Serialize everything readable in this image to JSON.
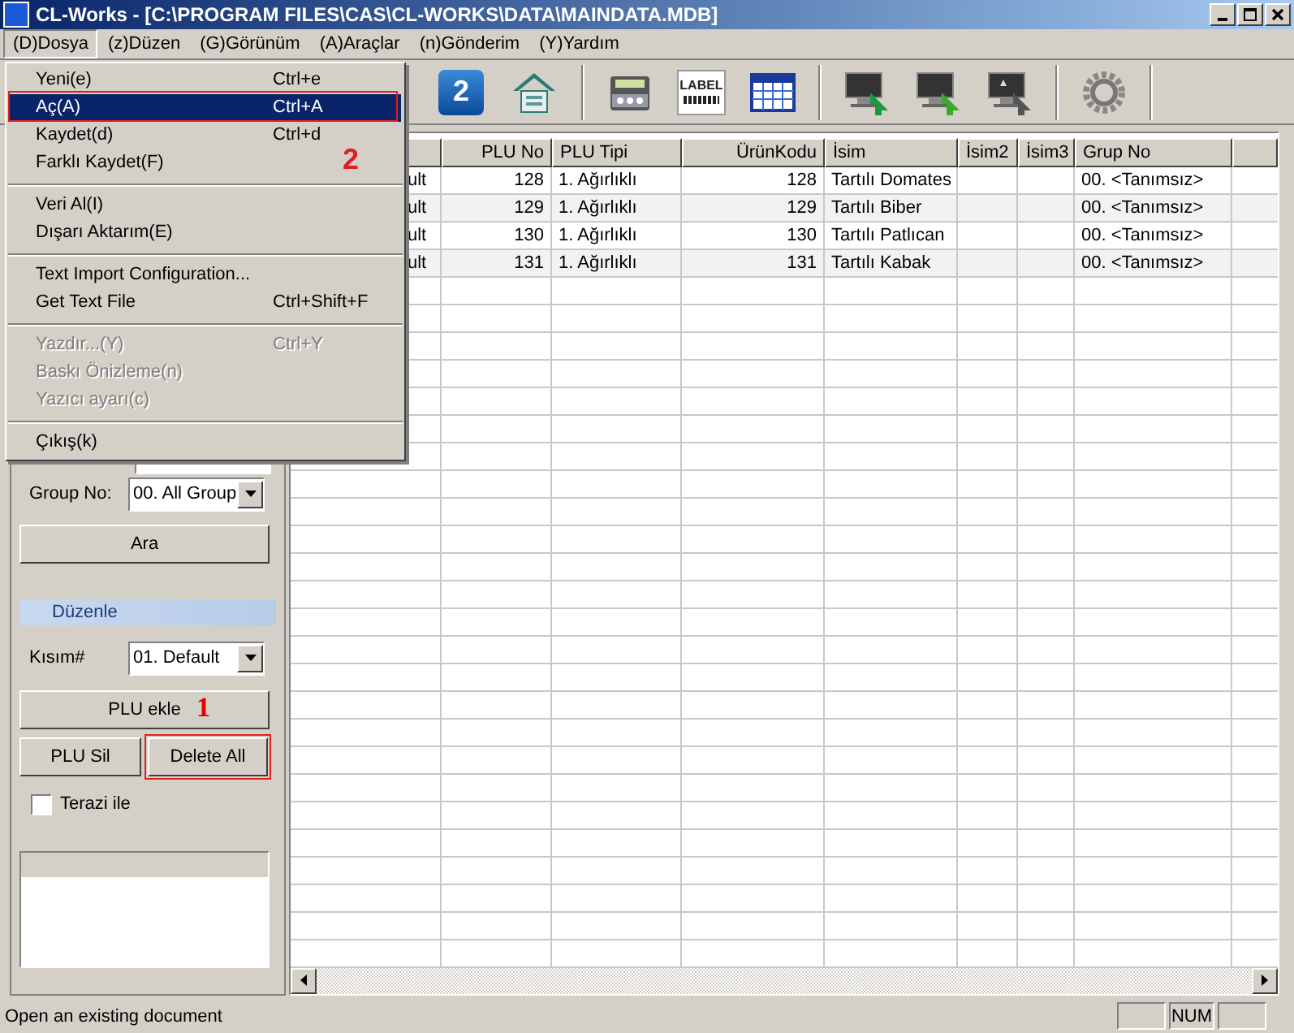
{
  "window": {
    "title": "CL-Works - [C:\\PROGRAM FILES\\CAS\\CL-WORKS\\DATA\\MAINDATA.MDB]"
  },
  "menu_bar": [
    {
      "label": "(D)Dosya",
      "selected": true
    },
    {
      "label": "(z)Düzen",
      "selected": false
    },
    {
      "label": "(G)Görünüm",
      "selected": false
    },
    {
      "label": "(A)Araçlar",
      "selected": false
    },
    {
      "label": "(n)Gönderim",
      "selected": false
    },
    {
      "label": "(Y)Yardım",
      "selected": false
    }
  ],
  "file_menu": {
    "annotation": "2",
    "items": [
      {
        "kind": "item",
        "label": "Yeni(e)",
        "shortcut": "Ctrl+e",
        "disabled": false,
        "selected": false
      },
      {
        "kind": "item",
        "label": "Aç(A)",
        "shortcut": "Ctrl+A",
        "disabled": false,
        "selected": true
      },
      {
        "kind": "item",
        "label": "Kaydet(d)",
        "shortcut": "Ctrl+d",
        "disabled": false,
        "selected": false
      },
      {
        "kind": "item",
        "label": "Farklı Kaydet(F)",
        "disabled": false,
        "selected": false
      },
      {
        "kind": "separator"
      },
      {
        "kind": "item",
        "label": "Veri Al(I)",
        "disabled": false,
        "selected": false
      },
      {
        "kind": "item",
        "label": "Dışarı Aktarım(E)",
        "disabled": false,
        "selected": false
      },
      {
        "kind": "separator"
      },
      {
        "kind": "item",
        "label": "Text Import Configuration...",
        "disabled": false,
        "selected": false
      },
      {
        "kind": "item",
        "label": "Get Text File",
        "shortcut": "Ctrl+Shift+F",
        "disabled": false,
        "selected": false
      },
      {
        "kind": "separator"
      },
      {
        "kind": "item",
        "label": "Yazdır...(Y)",
        "shortcut": "Ctrl+Y",
        "disabled": true,
        "selected": false
      },
      {
        "kind": "item",
        "label": "Baskı Önizleme(n)",
        "disabled": true,
        "selected": false
      },
      {
        "kind": "item",
        "label": "Yazıcı ayarı(c)",
        "disabled": true,
        "selected": false
      },
      {
        "kind": "separator"
      },
      {
        "kind": "item",
        "label": "Çıkış(k)",
        "disabled": false,
        "selected": false
      }
    ]
  },
  "toolbar": [
    {
      "kind": "number",
      "text": "2"
    },
    {
      "kind": "house"
    },
    {
      "kind": "separator"
    },
    {
      "kind": "scale"
    },
    {
      "kind": "label",
      "text": "LABEL"
    },
    {
      "kind": "grid"
    },
    {
      "kind": "separator"
    },
    {
      "kind": "monitor-green"
    },
    {
      "kind": "monitor-down"
    },
    {
      "kind": "monitor-star"
    },
    {
      "kind": "separator"
    },
    {
      "kind": "gear"
    },
    {
      "kind": "separator"
    }
  ],
  "search": {
    "group_label": "Group No:",
    "group_value": "00. All Group",
    "button": "Ara"
  },
  "edit": {
    "title": "Düzenle",
    "section_label": "Kısım#",
    "section_value": "01. Default",
    "add_button": "PLU ekle",
    "annotation": "1",
    "delete_button": "PLU Sil",
    "delete_all_button": "Delete All",
    "scale_checkbox": {
      "label": "Terazi ile",
      "checked": false
    }
  },
  "table": {
    "columns": [
      {
        "label": "PLU No",
        "kind": "number"
      },
      {
        "label": "PLU Tipi",
        "kind": "text"
      },
      {
        "label": "ÜrünKodu",
        "kind": "number"
      },
      {
        "label": "İsim",
        "kind": "text"
      },
      {
        "label": "İsim2",
        "kind": "text"
      },
      {
        "label": "İsim3",
        "kind": "text"
      },
      {
        "label": "Grup No",
        "kind": "text"
      }
    ],
    "rows": [
      {
        "column_1": "ult",
        "cells": [
          "128",
          "1. Ağırlıklı",
          "128",
          "Tartılı Domates",
          "",
          "",
          "00. <Tanımsız>"
        ]
      },
      {
        "column_1": "ult",
        "cells": [
          "129",
          "1. Ağırlıklı",
          "129",
          "Tartılı Biber",
          "",
          "",
          "00. <Tanımsız>"
        ]
      },
      {
        "column_1": "ult",
        "cells": [
          "130",
          "1. Ağırlıklı",
          "130",
          "Tartılı Patlıcan",
          "",
          "",
          "00. <Tanımsız>"
        ]
      },
      {
        "column_1": "ult",
        "cells": [
          "131",
          "1. Ağırlıklı",
          "131",
          "Tartılı Kabak",
          "",
          "",
          "00. <Tanımsız>"
        ]
      }
    ]
  },
  "status_bar": {
    "message": "Open an existing document",
    "indicators": [
      "NUM"
    ]
  }
}
